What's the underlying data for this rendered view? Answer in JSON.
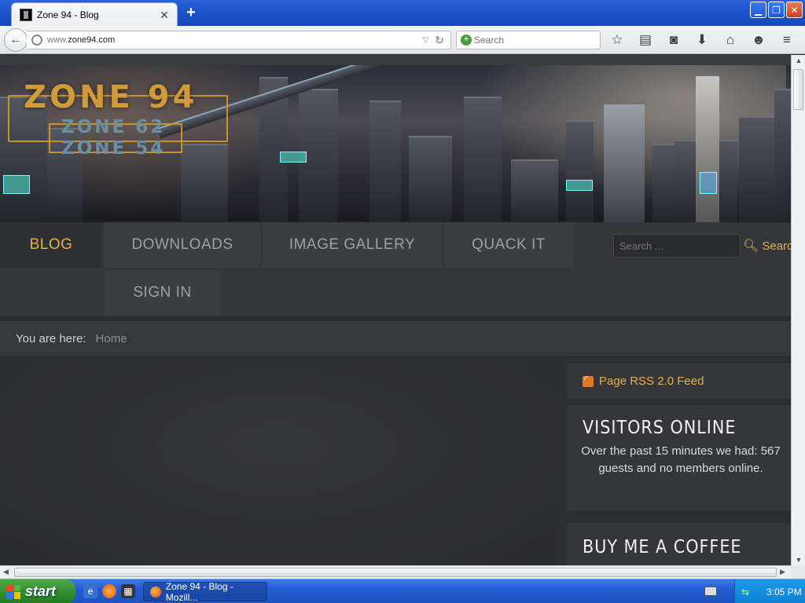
{
  "browser": {
    "tab_title": "Zone 94 - Blog",
    "tab_close": "✕",
    "new_tab": "+",
    "window_buttons": {
      "minimize": "▁",
      "maximize": "❐",
      "close": "✕"
    },
    "url_prefix": "www.",
    "url_domain": "zone94.com",
    "search_placeholder": "Search",
    "toolbar_icons": [
      "star-icon",
      "reading-list-icon",
      "pocket-icon",
      "download-icon",
      "home-icon",
      "chat-icon",
      "menu-icon"
    ]
  },
  "site": {
    "logo_main": "ZONE 94",
    "logo_sub1": "ZONE 62",
    "logo_sub2": "ZONE 54",
    "menu": {
      "blog": "BLOG",
      "downloads": "DOWNLOADS",
      "image_gallery": "IMAGE GALLERY",
      "quack_it": "QUACK IT",
      "sign_in": "SIGN IN"
    },
    "search_placeholder": "Search ...",
    "search_button": "Search",
    "breadcrumb": {
      "label": "You are here:",
      "home": "Home"
    },
    "rss_label": "Page RSS 2.0 Feed",
    "visitors": {
      "title": "VISITORS ONLINE",
      "text": "Over the past 15 minutes we had: 567 guests and no members online."
    },
    "coffee_title": "BUY ME A COFFEE"
  },
  "taskbar": {
    "start_label": "start",
    "task_label": "Zone 94 - Blog - Mozill...",
    "clock": "3:05 PM"
  },
  "colors": {
    "accent": "#e2b14e",
    "menu_text": "#9da0a5",
    "page_bg": "#2d2e30"
  }
}
